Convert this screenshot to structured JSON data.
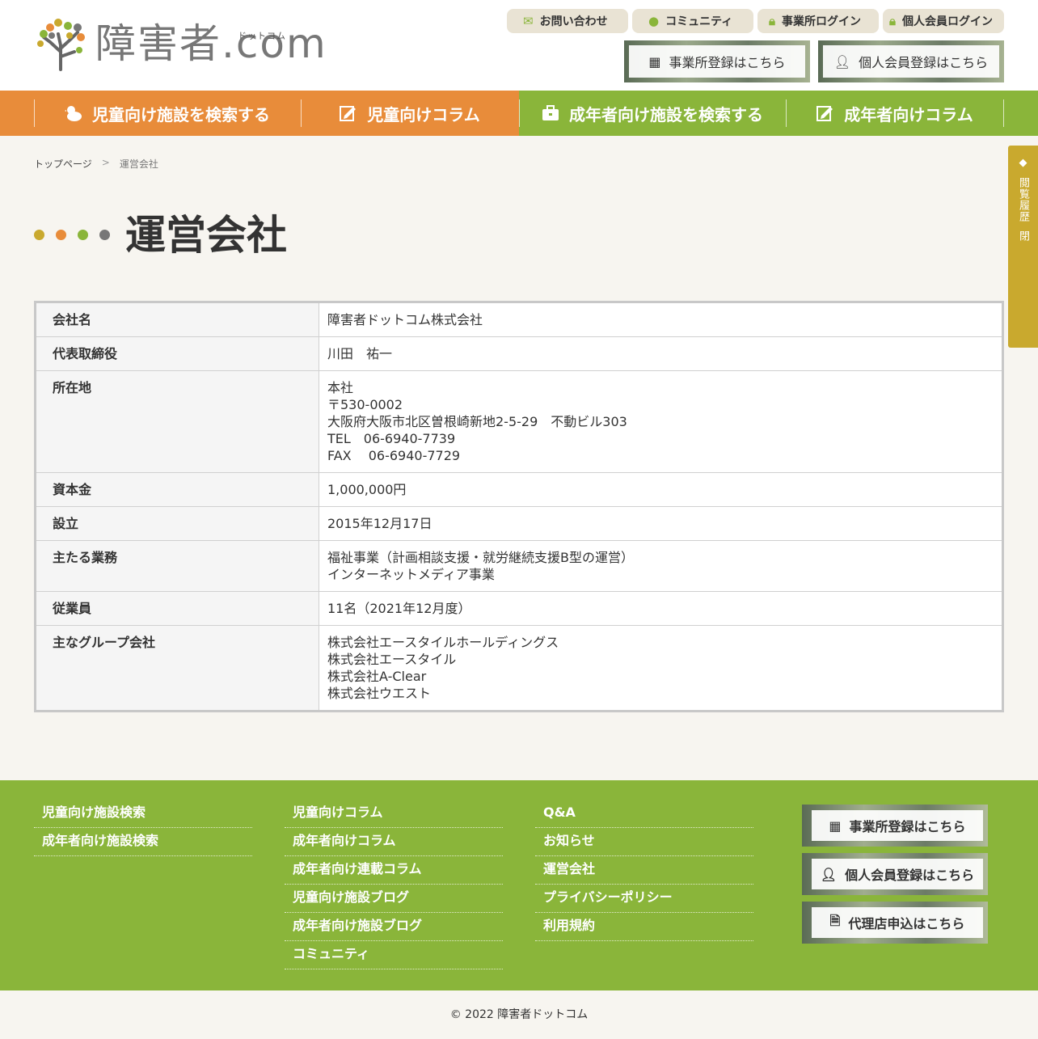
{
  "header": {
    "logo_text": "障害者.com",
    "logo_sub": "ドットコム",
    "top_links": [
      {
        "label": "お問い合わせ",
        "icon": "mail-icon"
      },
      {
        "label": "コミュニティ",
        "icon": "chat-icon"
      },
      {
        "label": "事業所ログイン",
        "icon": "lock-icon"
      },
      {
        "label": "個人会員ログイン",
        "icon": "lock-icon"
      }
    ],
    "register_buttons": [
      {
        "label": "事業所登録はこちら",
        "icon": "building-icon"
      },
      {
        "label": "個人会員登録はこちら",
        "icon": "person-icon"
      }
    ]
  },
  "nav": {
    "items": [
      {
        "label": "児童向け施設を検索する",
        "icon": "duck-icon"
      },
      {
        "label": "児童向けコラム",
        "icon": "edit-icon"
      },
      {
        "label": "成年者向け施設を検索する",
        "icon": "briefcase-icon"
      },
      {
        "label": "成年者向けコラム",
        "icon": "edit-icon"
      }
    ],
    "colors": {
      "orange": "#e88c3a",
      "green": "#8ab53a"
    }
  },
  "side_tab": {
    "label": "閲覧履歴",
    "close": "閉"
  },
  "breadcrumb": {
    "home": "トップページ",
    "separator": ">",
    "current": "運営会社"
  },
  "page_title": "運営会社",
  "dot_colors": [
    "#c9a92e",
    "#e88c3a",
    "#8ab53a",
    "#777777"
  ],
  "company_table": [
    {
      "label": "会社名",
      "lines": [
        "障害者ドットコム株式会社"
      ]
    },
    {
      "label": "代表取締役",
      "lines": [
        "川田　祐一"
      ]
    },
    {
      "label": "所在地",
      "lines": [
        "本社",
        "〒530-0002",
        "大阪府大阪市北区曽根崎新地2-5-29　不動ビル303",
        "TEL　06-6940-7739",
        "FAX　 06-6940-7729"
      ]
    },
    {
      "label": "資本金",
      "lines": [
        "1,000,000円"
      ]
    },
    {
      "label": "設立",
      "lines": [
        "2015年12月17日"
      ]
    },
    {
      "label": "主たる業務",
      "lines": [
        "福祉事業（計画相談支援・就労継続支援B型の運営）",
        "インターネットメディア事業"
      ]
    },
    {
      "label": "従業員",
      "lines": [
        "11名（2021年12月度）"
      ]
    },
    {
      "label": "主なグループ会社",
      "lines": [
        "株式会社エースタイルホールディングス",
        "株式会社エースタイル",
        "株式会社A-Clear",
        "株式会社ウエスト"
      ]
    }
  ],
  "footer": {
    "col1": [
      "児童向け施設検索",
      "成年者向け施設検索"
    ],
    "col2": [
      "児童向けコラム",
      "成年者向けコラム",
      "成年者向け連載コラム",
      "児童向け施設ブログ",
      "成年者向け施設ブログ",
      "コミュニティ"
    ],
    "col3": [
      "Q&A",
      "お知らせ",
      "運営会社",
      "プライバシーポリシー",
      "利用規約"
    ],
    "buttons": [
      {
        "label": "事業所登録はこちら",
        "icon": "building-icon"
      },
      {
        "label": "個人会員登録はこちら",
        "icon": "person-icon"
      },
      {
        "label": "代理店申込はこちら",
        "icon": "document-icon"
      }
    ],
    "copyright": "© 2022 障害者ドットコム"
  }
}
